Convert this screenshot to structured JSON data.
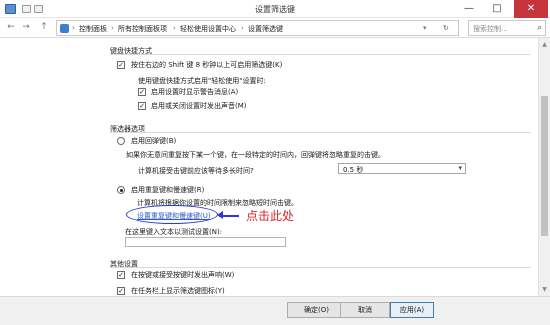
{
  "window": {
    "title": "设置筛选键",
    "minimize": "—",
    "maximize": "□",
    "close": "✕"
  },
  "address": {
    "back": "←",
    "forward": "→",
    "up": "↑",
    "crumbs": [
      "控制面板",
      "所有控制面板项",
      "轻松使用设置中心",
      "设置筛选键"
    ],
    "separator": "›",
    "refresh": "↻",
    "search_placeholder": "搜索控制...",
    "search_icon": "⌕"
  },
  "keyboard_shortcut": {
    "heading": "键盘快捷方式",
    "shift_option": "按住右边的 Shift 键 8 秒钟以上可启用筛选键(K)",
    "shift_checked": true,
    "note": "使用键盘快捷方式启用\"轻松使用\"设置时:",
    "warn_option": "启用设置时显示警告消息(A)",
    "warn_checked": true,
    "sound_option": "启用或关闭设置时发出声音(M)",
    "sound_checked": true
  },
  "filter_options": {
    "heading": "筛选器选项",
    "bounce_option": "启用回弹键(B)",
    "bounce_selected": false,
    "bounce_note": "如果你无意间重复按下某一个键，在一段特定的时间内，回弹键将忽略重复的击键。",
    "wait_label": "计算机接受击键前应该等待多长时间?",
    "wait_value": "0.5 秒",
    "repeat_option": "启用重复键和慢速键(R)",
    "repeat_selected": true,
    "repeat_note": "计算机将根据你设置的时间限制来忽略短时间击键。",
    "setup_link": "设置重复键和慢速键(U)",
    "annotation": "点击此处",
    "test_label": "在这里键入文本以测试设置(N):",
    "test_value": ""
  },
  "other_settings": {
    "heading": "其他设置",
    "beep_option": "在按键或接受按键时发出声响(W)",
    "beep_checked": true,
    "taskbar_option": "在任务栏上显示筛选键图标(Y)",
    "taskbar_checked": true
  },
  "buttons": {
    "ok": "确定(O)",
    "cancel": "取消",
    "apply": "应用(A)"
  }
}
